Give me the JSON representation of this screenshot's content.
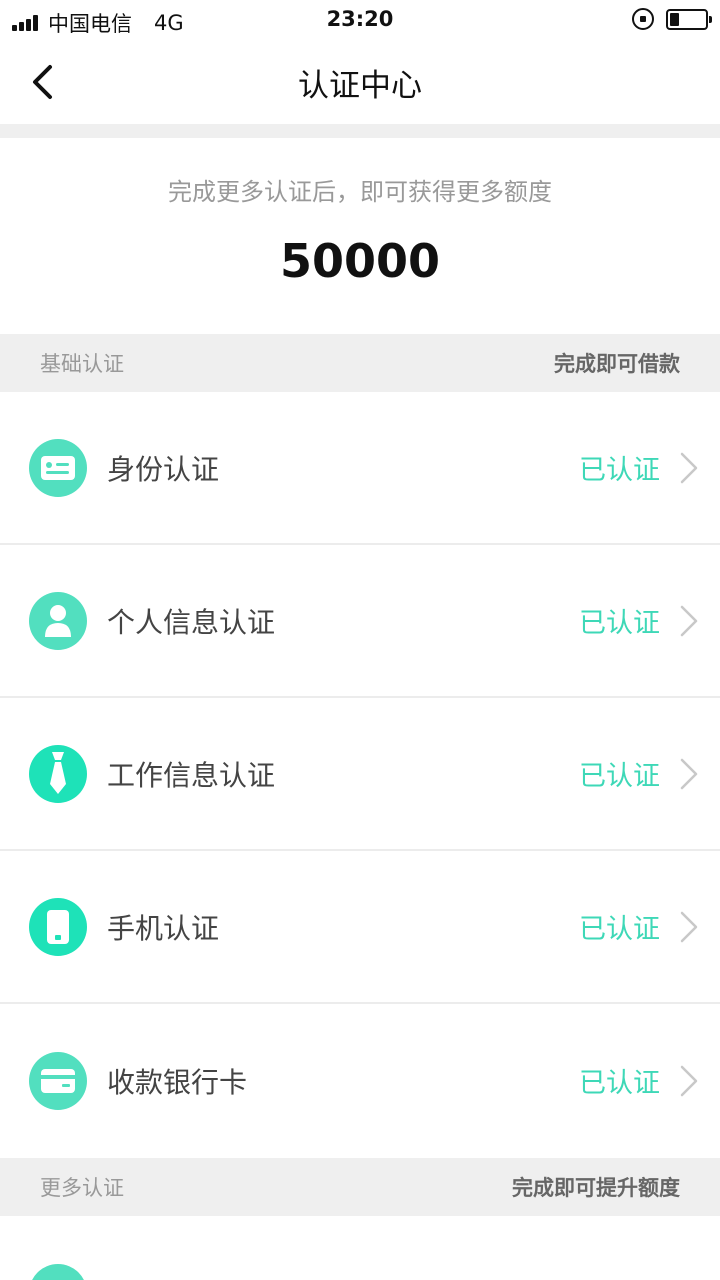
{
  "status_bar": {
    "carrier": "中国电信",
    "network": "4G",
    "time": "23:20"
  },
  "nav": {
    "title": "认证中心"
  },
  "summary": {
    "tip": "完成更多认证后，即可获得更多额度",
    "amount": "50000"
  },
  "basic_section": {
    "left": "基础认证",
    "right": "完成即可借款"
  },
  "items": [
    {
      "label": "身份认证",
      "status": "已认证",
      "icon": "id-card-icon"
    },
    {
      "label": "个人信息认证",
      "status": "已认证",
      "icon": "person-icon"
    },
    {
      "label": "工作信息认证",
      "status": "已认证",
      "icon": "tie-icon"
    },
    {
      "label": "手机认证",
      "status": "已认证",
      "icon": "phone-icon"
    },
    {
      "label": "收款银行卡",
      "status": "已认证",
      "icon": "bank-card-icon"
    }
  ],
  "more_section": {
    "left": "更多认证",
    "right": "完成即可提升额度"
  },
  "colors": {
    "accent": "#3ed8b7",
    "icon_bg": "#52dfbf",
    "section_bg": "#efefef"
  }
}
